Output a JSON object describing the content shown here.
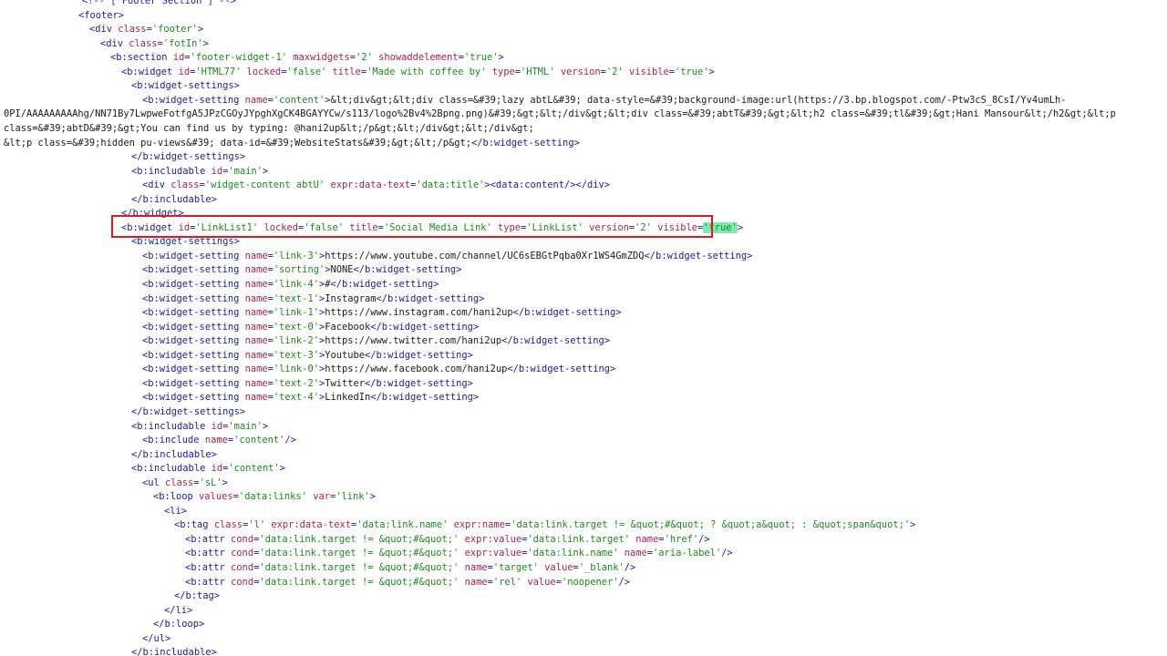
{
  "colors": {
    "background": "#ffffff",
    "tag": "#1a1aa6",
    "attribute": "#ab1f52",
    "value": "#1a8a1a",
    "text": "#1a1a1a",
    "highlight_box": "#e01a1a",
    "selection": "#7fe8b0"
  },
  "code_lines": [
    [
      [
        "t",
        "<!-- [ Footer Section ] -->"
      ]
    ],
    [
      [
        "t",
        "<footer>"
      ]
    ],
    [
      [
        "t",
        "<div "
      ],
      [
        "a",
        "class"
      ],
      [
        "t",
        "="
      ],
      [
        "v",
        "'footer'"
      ],
      [
        "t",
        ">"
      ]
    ],
    [
      [
        "t",
        "<div "
      ],
      [
        "a",
        "class"
      ],
      [
        "t",
        "="
      ],
      [
        "v",
        "'fotIn'"
      ],
      [
        "t",
        ">"
      ]
    ],
    [
      [
        "t",
        "<b:section "
      ],
      [
        "a",
        "id"
      ],
      [
        "t",
        "="
      ],
      [
        "v",
        "'footer-widget-1'"
      ],
      [
        "t",
        " "
      ],
      [
        "a",
        "maxwidgets"
      ],
      [
        "t",
        "="
      ],
      [
        "v",
        "'2'"
      ],
      [
        "t",
        " "
      ],
      [
        "a",
        "showaddelement"
      ],
      [
        "t",
        "="
      ],
      [
        "v",
        "'true'"
      ],
      [
        "t",
        ">"
      ]
    ],
    [
      [
        "t",
        "<b:widget "
      ],
      [
        "a",
        "id"
      ],
      [
        "t",
        "="
      ],
      [
        "v",
        "'HTML77'"
      ],
      [
        "t",
        " "
      ],
      [
        "a",
        "locked"
      ],
      [
        "t",
        "="
      ],
      [
        "v",
        "'false'"
      ],
      [
        "t",
        " "
      ],
      [
        "a",
        "title"
      ],
      [
        "t",
        "="
      ],
      [
        "v",
        "'Made with coffee by'"
      ],
      [
        "t",
        " "
      ],
      [
        "a",
        "type"
      ],
      [
        "t",
        "="
      ],
      [
        "v",
        "'HTML'"
      ],
      [
        "t",
        " "
      ],
      [
        "a",
        "version"
      ],
      [
        "t",
        "="
      ],
      [
        "v",
        "'2'"
      ],
      [
        "t",
        " "
      ],
      [
        "a",
        "visible"
      ],
      [
        "t",
        "="
      ],
      [
        "v",
        "'true'"
      ],
      [
        "t",
        ">"
      ]
    ],
    [
      [
        "t",
        "<b:widget-settings>"
      ]
    ],
    [
      [
        "t",
        "<b:widget-setting "
      ],
      [
        "a",
        "name"
      ],
      [
        "t",
        "="
      ],
      [
        "v",
        "'content'"
      ],
      [
        "t",
        ">"
      ],
      [
        "x",
        "&lt;div&gt;&lt;div class=&#39;lazy abtL&#39; data-style=&#39;background-image:url(https://3.bp.blogspot.com/-Ptw3cS_8CsI/Yv4umLh-"
      ]
    ],
    [
      [
        "x",
        "0PI/AAAAAAAAAhg/NN71By7LwpweFotfgA5JPzCGOyJYpghXgCK4BGAYYCw/s113/logo%2Bv4%2Bpng.png)&#39;&gt;&lt;/div&gt;&lt;div class=&#39;abtT&#39;&gt;&lt;h2 class=&#39;tl&#39;&gt;Hani Mansour&lt;/h2&gt;&lt;p"
      ]
    ],
    [
      [
        "x",
        "class=&#39;abtD&#39;&gt;You can find us by typing: @hani2up&lt;/p&gt;&lt;/div&gt;&lt;/div&gt;"
      ]
    ],
    [
      [
        "x",
        "&lt;p class=&#39;hidden pu-views&#39; data-id=&#39;WebsiteStats&#39;&gt;&lt;/p&gt;"
      ],
      [
        "t",
        "</b:widget-setting>"
      ]
    ],
    [
      [
        "t",
        "</b:widget-settings>"
      ]
    ],
    [
      [
        "t",
        "<b:includable "
      ],
      [
        "a",
        "id"
      ],
      [
        "t",
        "="
      ],
      [
        "v",
        "'main'"
      ],
      [
        "t",
        ">"
      ]
    ],
    [
      [
        "t",
        "<div "
      ],
      [
        "a",
        "class"
      ],
      [
        "t",
        "="
      ],
      [
        "v",
        "'widget-content abtU'"
      ],
      [
        "t",
        " "
      ],
      [
        "a",
        "expr:data-text"
      ],
      [
        "t",
        "="
      ],
      [
        "v",
        "'data:title'"
      ],
      [
        "t",
        ">"
      ],
      [
        "t",
        "<data:content/>"
      ],
      [
        "t",
        "</div>"
      ]
    ],
    [
      [
        "t",
        "</b:includable>"
      ]
    ],
    [
      [
        "t",
        "</b:widget>"
      ]
    ],
    [
      [
        "t",
        "<b:widget "
      ],
      [
        "a",
        "id"
      ],
      [
        "t",
        "="
      ],
      [
        "v",
        "'LinkList1'"
      ],
      [
        "t",
        " "
      ],
      [
        "a",
        "locked"
      ],
      [
        "t",
        "="
      ],
      [
        "v",
        "'false'"
      ],
      [
        "t",
        " "
      ],
      [
        "a",
        "title"
      ],
      [
        "t",
        "="
      ],
      [
        "v",
        "'Social Media Link'"
      ],
      [
        "t",
        " "
      ],
      [
        "a",
        "type"
      ],
      [
        "t",
        "="
      ],
      [
        "v",
        "'LinkList'"
      ],
      [
        "t",
        " "
      ],
      [
        "a",
        "version"
      ],
      [
        "t",
        "="
      ],
      [
        "v",
        "'2'"
      ],
      [
        "t",
        " "
      ],
      [
        "a",
        "visible"
      ],
      [
        "t",
        "="
      ],
      [
        "hl",
        "'true'"
      ],
      [
        "t",
        ">"
      ]
    ],
    [
      [
        "t",
        "<b:widget-settings>"
      ]
    ],
    [
      [
        "t",
        "<b:widget-setting "
      ],
      [
        "a",
        "name"
      ],
      [
        "t",
        "="
      ],
      [
        "v",
        "'link-3'"
      ],
      [
        "t",
        ">"
      ],
      [
        "x",
        "https://www.youtube.com/channel/UC6sEBGtPqba0Xr1WS4GmZDQ"
      ],
      [
        "t",
        "</b:widget-setting>"
      ]
    ],
    [
      [
        "t",
        "<b:widget-setting "
      ],
      [
        "a",
        "name"
      ],
      [
        "t",
        "="
      ],
      [
        "v",
        "'sorting'"
      ],
      [
        "t",
        ">"
      ],
      [
        "x",
        "NONE"
      ],
      [
        "t",
        "</b:widget-setting>"
      ]
    ],
    [
      [
        "t",
        "<b:widget-setting "
      ],
      [
        "a",
        "name"
      ],
      [
        "t",
        "="
      ],
      [
        "v",
        "'link-4'"
      ],
      [
        "t",
        ">"
      ],
      [
        "x",
        "#"
      ],
      [
        "t",
        "</b:widget-setting>"
      ]
    ],
    [
      [
        "t",
        "<b:widget-setting "
      ],
      [
        "a",
        "name"
      ],
      [
        "t",
        "="
      ],
      [
        "v",
        "'text-1'"
      ],
      [
        "t",
        ">"
      ],
      [
        "x",
        "Instagram"
      ],
      [
        "t",
        "</b:widget-setting>"
      ]
    ],
    [
      [
        "t",
        "<b:widget-setting "
      ],
      [
        "a",
        "name"
      ],
      [
        "t",
        "="
      ],
      [
        "v",
        "'link-1'"
      ],
      [
        "t",
        ">"
      ],
      [
        "x",
        "https://www.instagram.com/hani2up"
      ],
      [
        "t",
        "</b:widget-setting>"
      ]
    ],
    [
      [
        "t",
        "<b:widget-setting "
      ],
      [
        "a",
        "name"
      ],
      [
        "t",
        "="
      ],
      [
        "v",
        "'text-0'"
      ],
      [
        "t",
        ">"
      ],
      [
        "x",
        "Facebook"
      ],
      [
        "t",
        "</b:widget-setting>"
      ]
    ],
    [
      [
        "t",
        "<b:widget-setting "
      ],
      [
        "a",
        "name"
      ],
      [
        "t",
        "="
      ],
      [
        "v",
        "'link-2'"
      ],
      [
        "t",
        ">"
      ],
      [
        "x",
        "https://www.twitter.com/hani2up"
      ],
      [
        "t",
        "</b:widget-setting>"
      ]
    ],
    [
      [
        "t",
        "<b:widget-setting "
      ],
      [
        "a",
        "name"
      ],
      [
        "t",
        "="
      ],
      [
        "v",
        "'text-3'"
      ],
      [
        "t",
        ">"
      ],
      [
        "x",
        "Youtube"
      ],
      [
        "t",
        "</b:widget-setting>"
      ]
    ],
    [
      [
        "t",
        "<b:widget-setting "
      ],
      [
        "a",
        "name"
      ],
      [
        "t",
        "="
      ],
      [
        "v",
        "'link-0'"
      ],
      [
        "t",
        ">"
      ],
      [
        "x",
        "https://www.facebook.com/hani2up"
      ],
      [
        "t",
        "</b:widget-setting>"
      ]
    ],
    [
      [
        "t",
        "<b:widget-setting "
      ],
      [
        "a",
        "name"
      ],
      [
        "t",
        "="
      ],
      [
        "v",
        "'text-2'"
      ],
      [
        "t",
        ">"
      ],
      [
        "x",
        "Twitter"
      ],
      [
        "t",
        "</b:widget-setting>"
      ]
    ],
    [
      [
        "t",
        "<b:widget-setting "
      ],
      [
        "a",
        "name"
      ],
      [
        "t",
        "="
      ],
      [
        "v",
        "'text-4'"
      ],
      [
        "t",
        ">"
      ],
      [
        "x",
        "LinkedIn"
      ],
      [
        "t",
        "</b:widget-setting>"
      ]
    ],
    [
      [
        "t",
        "</b:widget-settings>"
      ]
    ],
    [
      [
        "t",
        "<b:includable "
      ],
      [
        "a",
        "id"
      ],
      [
        "t",
        "="
      ],
      [
        "v",
        "'main'"
      ],
      [
        "t",
        ">"
      ]
    ],
    [
      [
        "t",
        "<b:include "
      ],
      [
        "a",
        "name"
      ],
      [
        "t",
        "="
      ],
      [
        "v",
        "'content'"
      ],
      [
        "t",
        "/>"
      ]
    ],
    [
      [
        "t",
        "</b:includable>"
      ]
    ],
    [
      [
        "t",
        "<b:includable "
      ],
      [
        "a",
        "id"
      ],
      [
        "t",
        "="
      ],
      [
        "v",
        "'content'"
      ],
      [
        "t",
        ">"
      ]
    ],
    [
      [
        "t",
        "<ul "
      ],
      [
        "a",
        "class"
      ],
      [
        "t",
        "="
      ],
      [
        "v",
        "'sL'"
      ],
      [
        "t",
        ">"
      ]
    ],
    [
      [
        "t",
        "<b:loop "
      ],
      [
        "a",
        "values"
      ],
      [
        "t",
        "="
      ],
      [
        "v",
        "'data:links'"
      ],
      [
        "t",
        " "
      ],
      [
        "a",
        "var"
      ],
      [
        "t",
        "="
      ],
      [
        "v",
        "'link'"
      ],
      [
        "t",
        ">"
      ]
    ],
    [
      [
        "t",
        "<li>"
      ]
    ],
    [
      [
        "t",
        "<b:tag "
      ],
      [
        "a",
        "class"
      ],
      [
        "t",
        "="
      ],
      [
        "v",
        "'l'"
      ],
      [
        "t",
        " "
      ],
      [
        "a",
        "expr:data-text"
      ],
      [
        "t",
        "="
      ],
      [
        "v",
        "'data:link.name'"
      ],
      [
        "t",
        " "
      ],
      [
        "a",
        "expr:name"
      ],
      [
        "t",
        "="
      ],
      [
        "v",
        "'data:link.target != &quot;#&quot; ? &quot;a&quot; : &quot;span&quot;'"
      ],
      [
        "t",
        ">"
      ]
    ],
    [
      [
        "t",
        "<b:attr "
      ],
      [
        "a",
        "cond"
      ],
      [
        "t",
        "="
      ],
      [
        "v",
        "'data:link.target != &quot;#&quot;'"
      ],
      [
        "t",
        " "
      ],
      [
        "a",
        "expr:value"
      ],
      [
        "t",
        "="
      ],
      [
        "v",
        "'data:link.target'"
      ],
      [
        "t",
        " "
      ],
      [
        "a",
        "name"
      ],
      [
        "t",
        "="
      ],
      [
        "v",
        "'href'"
      ],
      [
        "t",
        "/>"
      ]
    ],
    [
      [
        "t",
        "<b:attr "
      ],
      [
        "a",
        "cond"
      ],
      [
        "t",
        "="
      ],
      [
        "v",
        "'data:link.target != &quot;#&quot;'"
      ],
      [
        "t",
        " "
      ],
      [
        "a",
        "expr:value"
      ],
      [
        "t",
        "="
      ],
      [
        "v",
        "'data:link.name'"
      ],
      [
        "t",
        " "
      ],
      [
        "a",
        "name"
      ],
      [
        "t",
        "="
      ],
      [
        "v",
        "'aria-label'"
      ],
      [
        "t",
        "/>"
      ]
    ],
    [
      [
        "t",
        "<b:attr "
      ],
      [
        "a",
        "cond"
      ],
      [
        "t",
        "="
      ],
      [
        "v",
        "'data:link.target != &quot;#&quot;'"
      ],
      [
        "t",
        " "
      ],
      [
        "a",
        "name"
      ],
      [
        "t",
        "="
      ],
      [
        "v",
        "'target'"
      ],
      [
        "t",
        " "
      ],
      [
        "a",
        "value"
      ],
      [
        "t",
        "="
      ],
      [
        "v",
        "'_blank'"
      ],
      [
        "t",
        "/>"
      ]
    ],
    [
      [
        "t",
        "<b:attr "
      ],
      [
        "a",
        "cond"
      ],
      [
        "t",
        "="
      ],
      [
        "v",
        "'data:link.target != &quot;#&quot;'"
      ],
      [
        "t",
        " "
      ],
      [
        "a",
        "name"
      ],
      [
        "t",
        "="
      ],
      [
        "v",
        "'rel'"
      ],
      [
        "t",
        " "
      ],
      [
        "a",
        "value"
      ],
      [
        "t",
        "="
      ],
      [
        "v",
        "'noopener'"
      ],
      [
        "t",
        "/>"
      ]
    ],
    [
      [
        "t",
        "</b:tag>"
      ]
    ],
    [
      [
        "t",
        "</li>"
      ]
    ],
    [
      [
        "t",
        "</b:loop>"
      ]
    ],
    [
      [
        "t",
        "</ul>"
      ]
    ],
    [
      [
        "t",
        "</b:includable>"
      ]
    ]
  ]
}
